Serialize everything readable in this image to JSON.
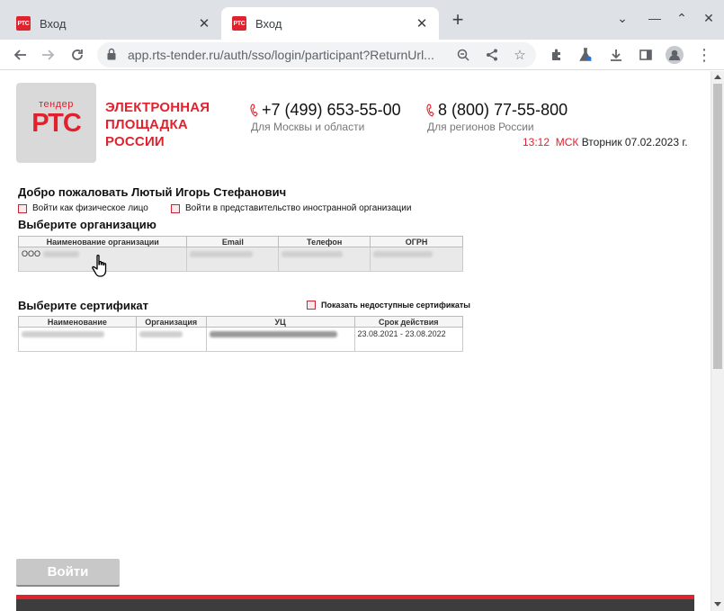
{
  "browser": {
    "tabs": [
      {
        "favicon": "РТС",
        "title": "Вход",
        "active": false
      },
      {
        "favicon": "РТС",
        "title": "Вход",
        "active": true
      }
    ],
    "url": "app.rts-tender.ru/auth/sso/login/participant?ReturnUrl..."
  },
  "header": {
    "logo_top": "тендер",
    "logo_main": "РТС",
    "logo_text_1": "ЭЛЕКТРОННАЯ",
    "logo_text_2": "ПЛОЩАДКА",
    "logo_text_3": "РОССИИ",
    "phone1": "+7 (499) 653-55-00",
    "phone1_sub": "Для Москвы и области",
    "phone2": "8 (800) 77-55-800",
    "phone2_sub": "Для регионов России",
    "time": "13:12",
    "tz": "МСК",
    "date": "Вторник 07.02.2023 г."
  },
  "welcome": "Добро пожаловать Лютый Игорь Стефанович",
  "options": {
    "individual": "Войти как физическое лицо",
    "foreign": "Войти в представительство иностранной организации"
  },
  "org_section": {
    "title": "Выберите организацию",
    "columns": [
      "Наименование организации",
      "Email",
      "Телефон",
      "ОГРН"
    ],
    "rows": [
      {
        "name_prefix": "ООО"
      }
    ]
  },
  "cert_section": {
    "title": "Выберите сертификат",
    "show_unavailable": "Показать недоступные сертификаты",
    "columns": [
      "Наименование",
      "Организация",
      "УЦ",
      "Срок действия"
    ],
    "rows": [
      {
        "validity": "23.08.2021 - 23.08.2022"
      }
    ]
  },
  "login_button": "Войти",
  "colors": {
    "brand_red": "#e0222e",
    "checkbox_border": "#c8243a"
  }
}
